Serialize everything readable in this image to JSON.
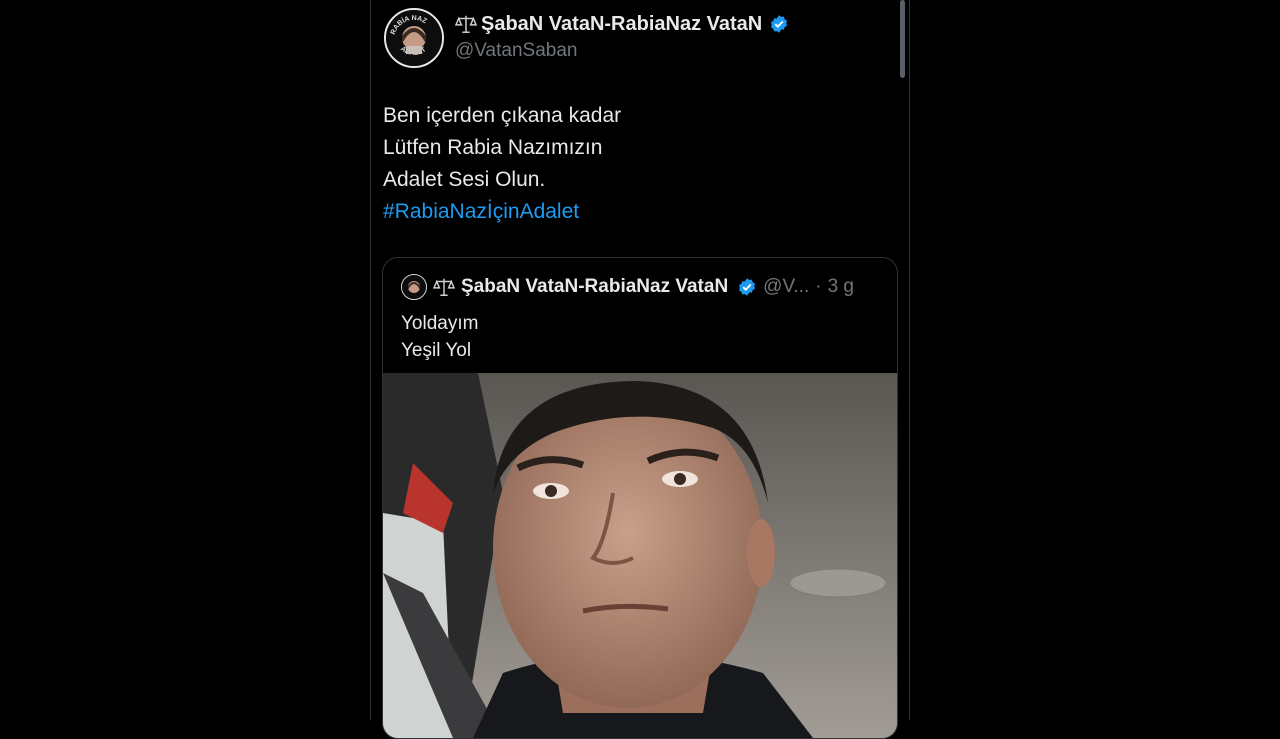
{
  "tweet": {
    "author_name": "ŞabaN VataN-RabiaNaz VataN",
    "author_handle": "@VatanSaban",
    "text_lines": [
      "Ben içerden çıkana kadar",
      "Lütfen Rabia Nazımızın",
      "Adalet Sesi Olun."
    ],
    "hashtag": "#RabiaNazİçinAdalet",
    "avatar_caption": "RABİA NAZ ADALET"
  },
  "quoted_tweet": {
    "author_name": "ŞabaN VataN-RabiaNaz VataN",
    "author_handle": "@V...",
    "separator": "·",
    "time": "3 g",
    "text_lines": [
      "Yoldayım",
      "Yeşil Yol"
    ]
  },
  "colors": {
    "background": "#000000",
    "text": "#e7e9ea",
    "muted": "#71767b",
    "accent": "#1d9bf0",
    "border": "#2f3336"
  },
  "icons": {
    "scale": "balance-scale-icon",
    "verified": "verified-badge-icon"
  }
}
